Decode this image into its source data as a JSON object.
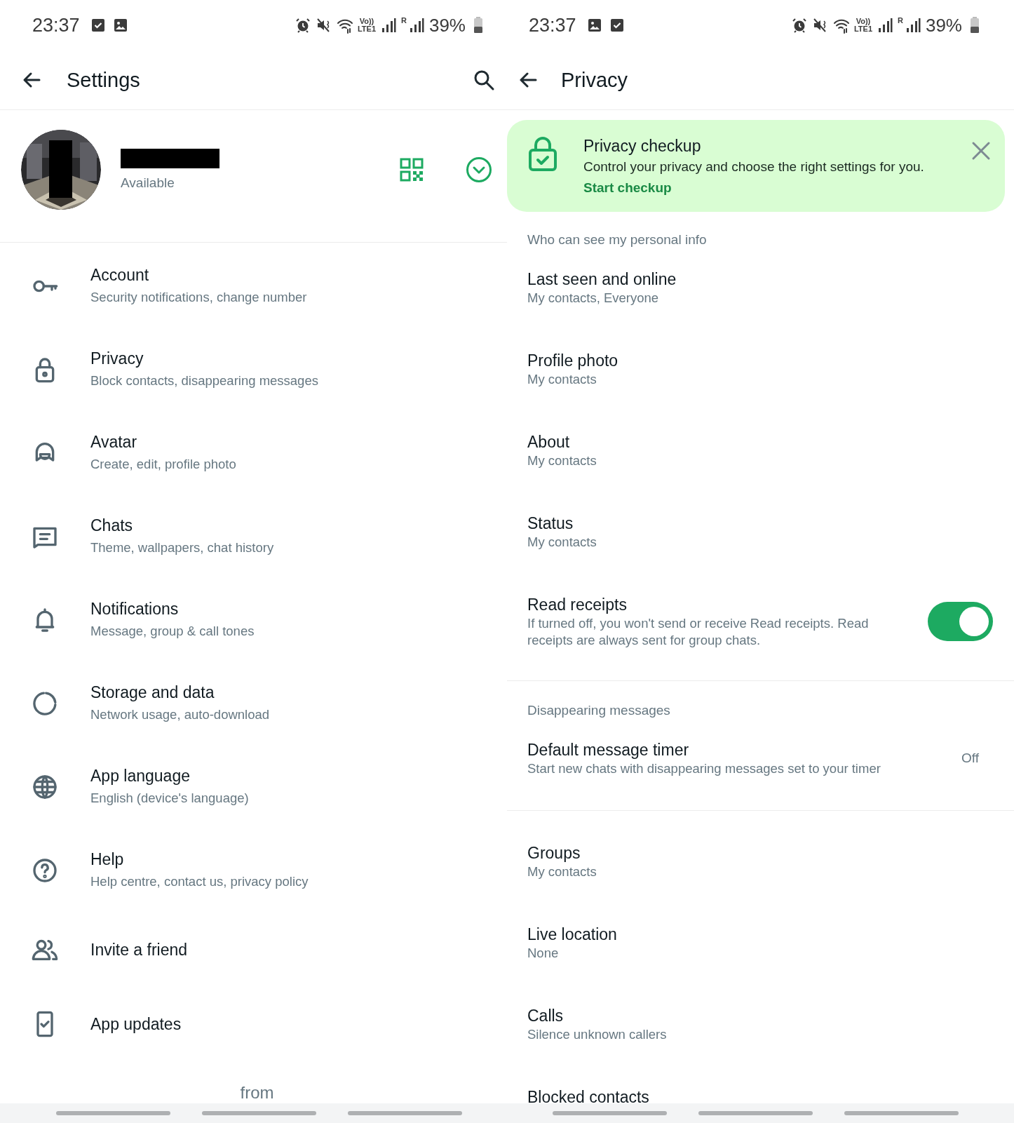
{
  "settings_screen": {
    "status_bar": {
      "time": "23:37",
      "notifications": [
        {
          "kind": "task"
        },
        {
          "kind": "gallery"
        }
      ],
      "volte": "Vo))",
      "lte": "LTE1",
      "roaming": "R",
      "battery": "39%"
    },
    "header": {
      "title": "Settings"
    },
    "profile": {
      "status": "Available"
    },
    "items": [
      {
        "title": "Account",
        "subtitle": "Security notifications, change number"
      },
      {
        "title": "Privacy",
        "subtitle": "Block contacts, disappearing messages"
      },
      {
        "title": "Avatar",
        "subtitle": "Create, edit, profile photo"
      },
      {
        "title": "Chats",
        "subtitle": "Theme, wallpapers, chat history"
      },
      {
        "title": "Notifications",
        "subtitle": "Message, group & call tones"
      },
      {
        "title": "Storage and data",
        "subtitle": "Network usage, auto-download"
      },
      {
        "title": "App language",
        "subtitle": "English (device's language)"
      },
      {
        "title": "Help",
        "subtitle": "Help centre, contact us, privacy policy"
      },
      {
        "title": "Invite a friend"
      },
      {
        "title": "App updates"
      }
    ],
    "footer": "from"
  },
  "privacy_screen": {
    "status_bar": {
      "time": "23:37",
      "notifications": [
        {
          "kind": "gallery"
        },
        {
          "kind": "task"
        }
      ],
      "volte": "Vo))",
      "lte": "LTE1",
      "roaming": "R",
      "battery": "39%"
    },
    "header": {
      "title": "Privacy"
    },
    "checkup_card": {
      "title": "Privacy checkup",
      "text": "Control your privacy and choose the right settings for you.",
      "link": "Start checkup"
    },
    "sections": [
      {
        "heading": "Who can see my personal info",
        "items": [
          {
            "kind": "text",
            "title": "Last seen and online",
            "subtitle": "My contacts, Everyone"
          },
          {
            "kind": "text",
            "title": "Profile photo",
            "subtitle": "My contacts"
          },
          {
            "kind": "text",
            "title": "About",
            "subtitle": "My contacts"
          },
          {
            "kind": "text",
            "title": "Status",
            "subtitle": "My contacts"
          },
          {
            "kind": "toggle",
            "title": "Read receipts",
            "subtitle": "If turned off, you won't send or receive Read receipts. Read receipts are always sent for group chats.",
            "on": true
          }
        ]
      },
      {
        "heading": "Disappearing messages",
        "items": [
          {
            "kind": "value",
            "title": "Default message timer",
            "subtitle": "Start new chats with disappearing messages set to your timer",
            "value": "Off"
          }
        ]
      },
      {
        "items": [
          {
            "kind": "text",
            "title": "Groups",
            "subtitle": "My contacts"
          },
          {
            "kind": "text",
            "title": "Live location",
            "subtitle": "None"
          },
          {
            "kind": "text",
            "title": "Calls",
            "subtitle": "Silence unknown callers"
          },
          {
            "kind": "text",
            "title": "Blocked contacts"
          }
        ]
      }
    ]
  }
}
